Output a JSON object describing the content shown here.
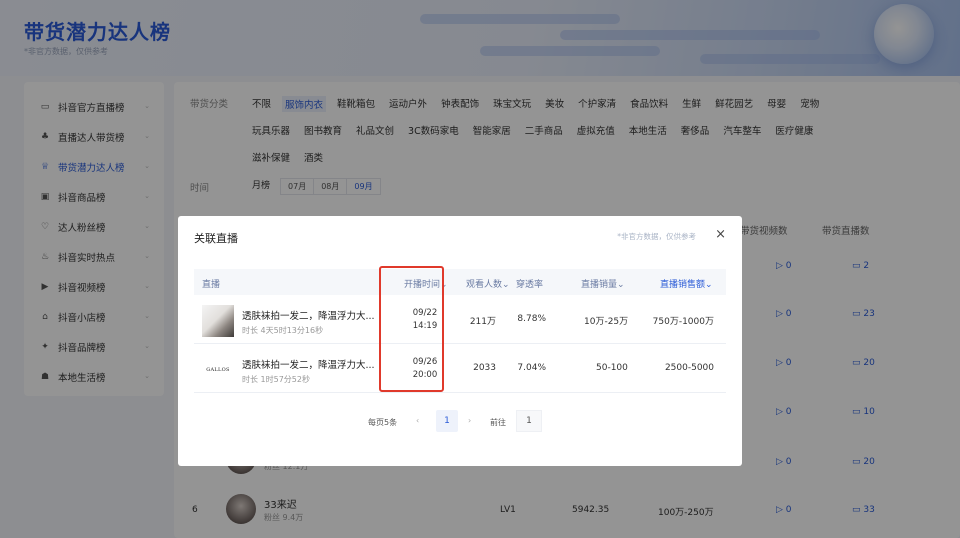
{
  "header": {
    "title": "带货潜力达人榜",
    "subtitle": "*非官方数据，仅供参考"
  },
  "sidebar": {
    "items": [
      {
        "label": "抖音官方直播榜",
        "icon": "tv-icon",
        "glyph": "▭",
        "active": false
      },
      {
        "label": "直播达人带货榜",
        "icon": "users-icon",
        "glyph": "♣",
        "active": false
      },
      {
        "label": "带货潜力达人榜",
        "icon": "trophy-icon",
        "glyph": "♕",
        "active": true
      },
      {
        "label": "抖音商品榜",
        "icon": "box-icon",
        "glyph": "▣",
        "active": false
      },
      {
        "label": "达人粉丝榜",
        "icon": "heart-icon",
        "glyph": "♡",
        "active": false
      },
      {
        "label": "抖音实时热点",
        "icon": "fire-icon",
        "glyph": "♨",
        "active": false
      },
      {
        "label": "抖音视频榜",
        "icon": "video-icon",
        "glyph": "▶",
        "active": false
      },
      {
        "label": "抖音小店榜",
        "icon": "shop-icon",
        "glyph": "⌂",
        "active": false
      },
      {
        "label": "抖音品牌榜",
        "icon": "brand-icon",
        "glyph": "✦",
        "active": false
      },
      {
        "label": "本地生活榜",
        "icon": "location-icon",
        "glyph": "☗",
        "active": false
      }
    ]
  },
  "filters": {
    "category_label": "带货分类",
    "time_label": "时间",
    "row1": [
      "不限",
      "服饰内衣",
      "鞋靴箱包",
      "运动户外",
      "钟表配饰",
      "珠宝文玩",
      "美妆",
      "个护家清",
      "食品饮料",
      "生鲜",
      "鲜花园艺",
      "母婴",
      "宠物"
    ],
    "row2": [
      "玩具乐器",
      "图书教育",
      "礼品文创",
      "3C数码家电",
      "智能家居",
      "二手商品",
      "虚拟充值",
      "本地生活",
      "奢侈品",
      "汽车整车",
      "医疗健康"
    ],
    "row3": [
      "滋补保健",
      "酒类"
    ],
    "selected_category": "服饰内衣",
    "month_label": "月榜",
    "months": [
      "07月",
      "08月",
      "09月"
    ],
    "selected_month": "09月"
  },
  "background_table": {
    "col_video": "带货视频数",
    "col_live": "带货直播数",
    "rows": [
      {
        "video": "0",
        "live": "2"
      },
      {
        "video": "0",
        "live": "23"
      },
      {
        "video": "0",
        "live": "20"
      },
      {
        "video": "0",
        "live": "10"
      },
      {
        "video": "0",
        "live": "20",
        "fans": "粉丝 12.1万"
      },
      {
        "rank": "6",
        "name": "33来迟",
        "fans": "粉丝 9.4万",
        "level": "LV1",
        "score": "5942.35",
        "sales": "100万-250万",
        "video": "0",
        "live": "33"
      }
    ]
  },
  "modal": {
    "title": "关联直播",
    "note": "*非官方数据，仅供参考",
    "close": "×",
    "columns": {
      "live": "直播",
      "start_time": "开播时间",
      "viewers": "观看人数",
      "penetration": "穿透率",
      "sales_volume": "直播销量",
      "sales_amount": "直播销售额"
    },
    "rows": [
      {
        "title": "透肤袜拍一发二，降温浮力大...",
        "duration": "时长 4天5时13分16秒",
        "date": "09/22",
        "time": "14:19",
        "viewers": "211万",
        "penetration": "8.78%",
        "sales_volume": "10万-25万",
        "sales_amount": "750万-1000万",
        "thumb_text": ""
      },
      {
        "title": "透肤袜拍一发二，降温浮力大...",
        "duration": "时长 1时57分52秒",
        "date": "09/26",
        "time": "20:00",
        "viewers": "2033",
        "penetration": "7.04%",
        "sales_volume": "50-100",
        "sales_amount": "2500-5000",
        "thumb_text": "GALLOS"
      }
    ],
    "pager": {
      "per_page": "每页5条",
      "prev": "‹",
      "page": "1",
      "next": "›",
      "goto": "前往",
      "goto_value": "1"
    }
  }
}
